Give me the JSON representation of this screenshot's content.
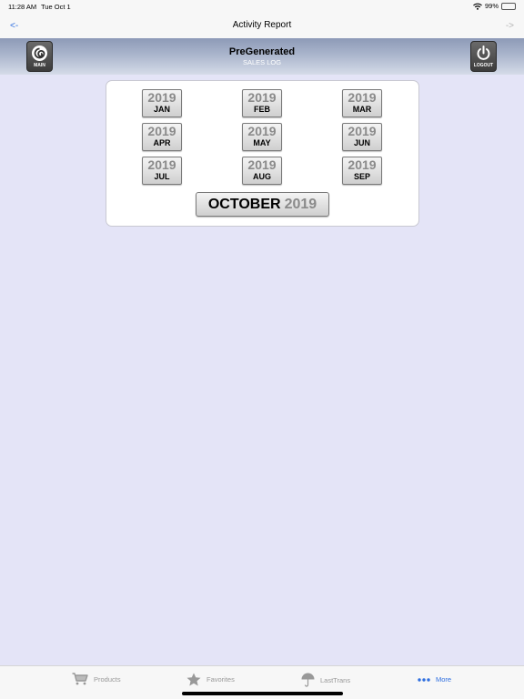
{
  "status_bar": {
    "time": "11:28 AM",
    "date": "Tue Oct 1",
    "battery_percent": "99%",
    "battery_level": 0.99,
    "icons": [
      "wifi-icon",
      "battery-icon"
    ]
  },
  "nav": {
    "back_label": "<-",
    "title": "Activity Report",
    "forward_label": "->"
  },
  "header": {
    "title": "PreGenerated",
    "subtitle": "SALES LOG",
    "main_button": {
      "label": "MAIN",
      "icon": "swirl-logo-icon"
    },
    "logout_button": {
      "label": "LOGOUT",
      "icon": "power-icon"
    }
  },
  "months": [
    {
      "year": "2019",
      "month": "JAN"
    },
    {
      "year": "2019",
      "month": "FEB"
    },
    {
      "year": "2019",
      "month": "MAR"
    },
    {
      "year": "2019",
      "month": "APR"
    },
    {
      "year": "2019",
      "month": "MAY"
    },
    {
      "year": "2019",
      "month": "JUN"
    },
    {
      "year": "2019",
      "month": "JUL"
    },
    {
      "year": "2019",
      "month": "AUG"
    },
    {
      "year": "2019",
      "month": "SEP"
    }
  ],
  "current": {
    "month": "OCTOBER",
    "year": "2019"
  },
  "tabs": [
    {
      "label": "Products",
      "icon": "cart-icon",
      "active": false
    },
    {
      "label": "Favorites",
      "icon": "star-icon",
      "active": false
    },
    {
      "label": "LastTrans",
      "icon": "umbrella-icon",
      "active": false
    },
    {
      "label": "More",
      "icon": "more-dots-icon",
      "active": true
    }
  ],
  "colors": {
    "accent": "#2f6fe0",
    "background": "#e4e4f7",
    "header_gradient_top": "#8d9ab7",
    "inactive_tab": "#999999",
    "battery": "#34c759"
  }
}
